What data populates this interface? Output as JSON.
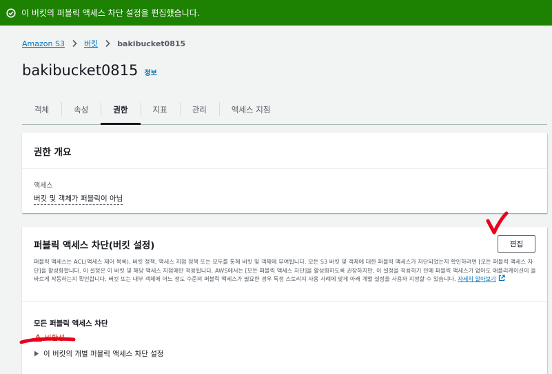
{
  "flash": {
    "message": "이 버킷의 퍼블릭 액세스 차단 설정을 편집했습니다.",
    "icon": "check-circle-icon",
    "color": "#1d8102"
  },
  "breadcrumb": {
    "items": [
      "Amazon S3",
      "버킷",
      "bakibucket0815"
    ]
  },
  "page": {
    "title": "bakibucket0815",
    "info_link": "정보"
  },
  "tabs": [
    {
      "label": "객체",
      "active": false
    },
    {
      "label": "속성",
      "active": false
    },
    {
      "label": "권한",
      "active": true
    },
    {
      "label": "지표",
      "active": false
    },
    {
      "label": "관리",
      "active": false
    },
    {
      "label": "액세스 지점",
      "active": false
    }
  ],
  "permissions_overview": {
    "title": "권한 개요",
    "access_label": "액세스",
    "access_value": "버킷 및 객체가 퍼블릭이 아님"
  },
  "public_access_block": {
    "title": "퍼블릭 액세스 차단(버킷 설정)",
    "edit_button": "편집",
    "description": "퍼블릭 액세스는 ACL(액세스 제어 목록), 버킷 정책, 액세스 지점 정책 또는 모두를 통해 버킷 및 객체에 부여됩니다. 모든 S3 버킷 및 객체에 대한 퍼블릭 액세스가 차단되었는지 확인하려면 [모든 퍼블릭 액세스 차단]을 활성화합니다. 이 설정은 이 버킷 및 해당 액세스 지점에만 적용됩니다. AWS에서는 [모든 퍼블릭 액세스 차단]을 활성화하도록 권장하지만, 이 설정을 적용하기 전에 퍼블릭 액세스가 없어도 애플리케이션이 올바르게 작동하는지 확인합니다. 버킷 또는 내부 객체에 어느 정도 수준의 퍼블릭 액세스가 필요한 경우 특정 스토리지 사용 사례에 맞게 아래 개별 설정을 사용자 지정할 수 있습니다.",
    "learn_more": "자세히 알아보기",
    "block_all_label": "모든 퍼블릭 액세스 차단",
    "block_all_status": "비활성",
    "status_color": "#d13212",
    "individual_settings_label": "이 버킷의 개별 퍼블릭 액세스 차단 설정"
  },
  "colors": {
    "link": "#0073bb",
    "annotation_red": "#e8001c"
  }
}
